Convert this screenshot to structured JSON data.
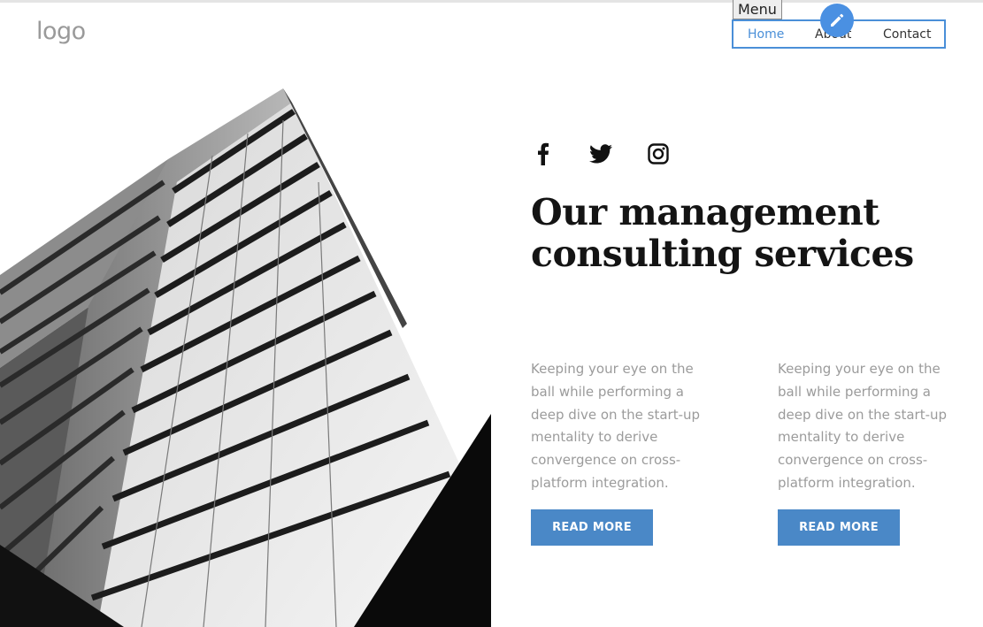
{
  "header": {
    "logo_text": "logo",
    "menu_label": "Menu",
    "nav": [
      {
        "label": "Home",
        "active": true
      },
      {
        "label": "About"
      },
      {
        "label": "Contact"
      }
    ],
    "edit_icon": "pencil-icon"
  },
  "social": [
    {
      "icon": "facebook-icon"
    },
    {
      "icon": "twitter-icon"
    },
    {
      "icon": "instagram-icon"
    }
  ],
  "main": {
    "headline": "Our management consulting services",
    "columns": [
      {
        "text": "Keeping your eye on the ball while performing a deep dive on the start-up mentality to derive convergence on cross-platform integration.",
        "button_label": "READ MORE"
      },
      {
        "text": "Keeping your eye on the ball while performing a deep dive on the start-up mentality to derive convergence on cross-platform integration.",
        "button_label": "READ MORE"
      }
    ]
  },
  "colors": {
    "accent": "#4a88c7",
    "nav_active": "#4a8fd8",
    "edit_button": "#4a90e2",
    "body_text": "#9b9b9b"
  }
}
